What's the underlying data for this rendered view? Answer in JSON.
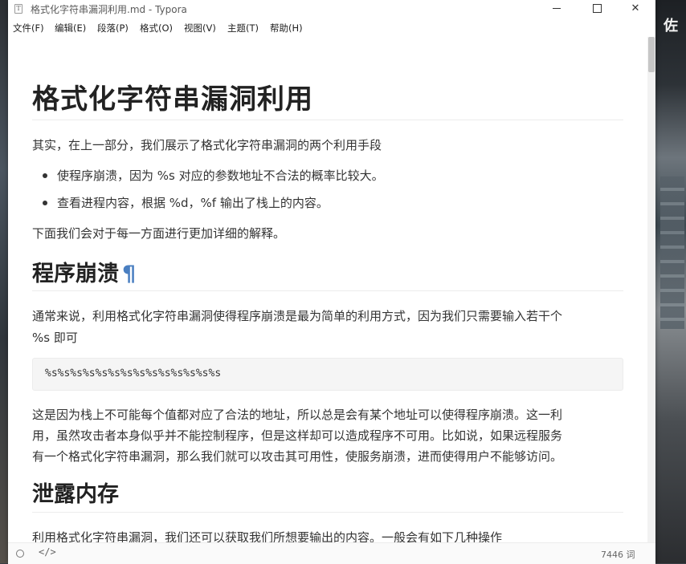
{
  "window": {
    "title": "格式化字符串漏洞利用.md - Typora",
    "app_icon": "T"
  },
  "window_controls": {
    "minimize_icon": "minimize-icon",
    "maximize_icon": "maximize-icon",
    "close_glyph": "✕"
  },
  "menu": {
    "items": [
      {
        "label": "文件(F)"
      },
      {
        "label": "编辑(E)"
      },
      {
        "label": "段落(P)"
      },
      {
        "label": "格式(O)"
      },
      {
        "label": "视图(V)"
      },
      {
        "label": "主题(T)"
      },
      {
        "label": "帮助(H)"
      }
    ]
  },
  "document": {
    "title": "格式化字符串漏洞利用",
    "intro": "其实，在上一部分，我们展示了格式化字符串漏洞的两个利用手段",
    "bullets": [
      "使程序崩溃，因为 %s 对应的参数地址不合法的概率比较大。",
      "查看进程内容，根据 %d，%f 输出了栈上的内容。"
    ],
    "followup": "下面我们会对于每一方面进行更加详细的解释。",
    "section1": {
      "heading": "程序崩溃",
      "anchor": "¶",
      "para1_line1": "通常来说，利用格式化字符串漏洞使得程序崩溃是最为简单的利用方式，因为我们只需要输入若干个",
      "para1_line2": "%s 即可",
      "code": "%s%s%s%s%s%s%s%s%s%s%s%s%s%s",
      "para2_line1": "这是因为栈上不可能每个值都对应了合法的地址，所以总是会有某个地址可以使得程序崩溃。这一利",
      "para2_line2": "用，虽然攻击者本身似乎并不能控制程序，但是这样却可以造成程序不可用。比如说，如果远程服务",
      "para2_line3": "有一个格式化字符串漏洞，那么我们就可以攻击其可用性，使服务崩溃，进而使得用户不能够访问。"
    },
    "section2": {
      "heading": "泄露内存",
      "partial": "利用格式化字符串漏洞，我们还可以获取我们所想要输出的内容。一般会有如下几种操作"
    }
  },
  "statusbar": {
    "source_toggle": "</>",
    "word_count": "7446 词"
  },
  "background": {
    "right_char": "佐"
  }
}
